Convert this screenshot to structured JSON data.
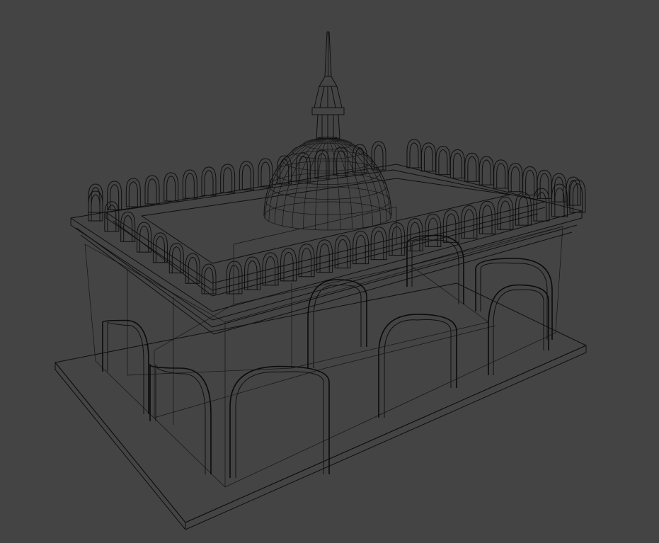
{
  "viewport": {
    "background": "#444444",
    "wire_color": "#0f0f0f",
    "render_mode": "wireframe",
    "subject": "mosque-wireframe-model"
  }
}
